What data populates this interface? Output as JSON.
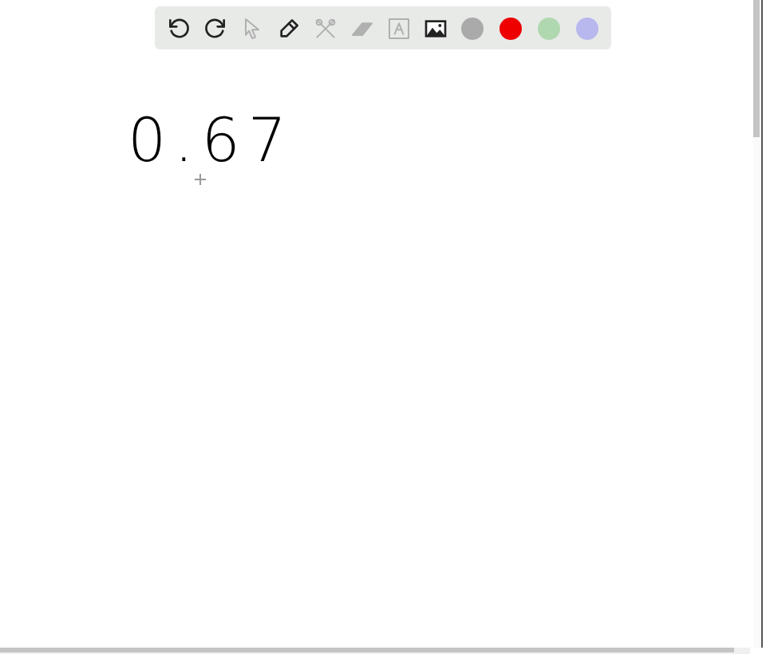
{
  "toolbar": {
    "tools": [
      {
        "kind": "undo",
        "disabled": false
      },
      {
        "kind": "redo",
        "disabled": false
      },
      {
        "kind": "pointer",
        "disabled": true
      },
      {
        "kind": "pen",
        "disabled": false
      },
      {
        "kind": "tools",
        "disabled": true
      },
      {
        "kind": "eraser",
        "disabled": true
      },
      {
        "kind": "text",
        "disabled": true
      },
      {
        "kind": "image",
        "disabled": false
      }
    ],
    "colors": [
      {
        "color": "#aaaaaa"
      },
      {
        "color": "#ee0000"
      },
      {
        "color": "#b0d8b0"
      },
      {
        "color": "#b8b8ee"
      }
    ]
  },
  "canvas": {
    "ink_text": "0.67"
  }
}
